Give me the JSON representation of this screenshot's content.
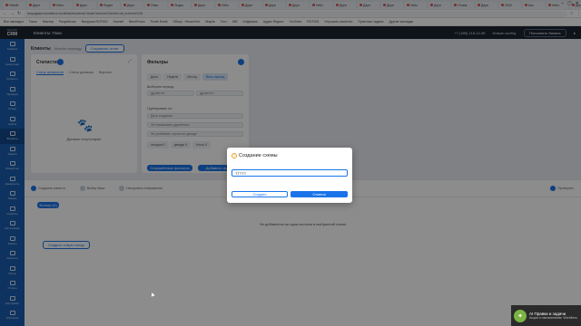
{
  "browser": {
    "tabs": [
      "HelloB",
      "Дерп",
      "Hello",
      "Дерп",
      "Яндек",
      "Дерп",
      "Obse",
      "Яндек",
      "Дерп",
      "Hello",
      "Дерп",
      "Дерп",
      "Дерп",
      "Hello",
      "Дерп",
      "Дерп",
      "Дерп",
      "Hello",
      "Дерп",
      "Отзыв",
      "Дерп",
      "2000",
      "Бак",
      "Hello",
      "Дерп",
      "Ct",
      "Дерп",
      "Дерп"
    ],
    "active_tab_index": 25,
    "url": "вгорадмин.worldlens.ru/clients/#schemeCreate?schemeClientId=all_scheme%3D",
    "bookmarks": [
      "Все закладки",
      "Таско",
      "Мастер",
      "Разработка",
      "Выгрузка ROTMO",
      "Kavneli",
      "BeneRoom",
      "Ponte Email",
      "Обзор - НескоГете",
      "Maplia",
      "Тест",
      "ИМ",
      "ИнДвижок",
      "Аудио Яндекс",
      "YouTube",
      "ROTMO",
      "Улучшить качество",
      "Пунктные задачи",
      "Другие закладки"
    ]
  },
  "topbar": {
    "logo_main": "CRM",
    "logo_sub": "MACRO",
    "page_name": "Клиенты: Поки",
    "phone": "+7 (495) 118-13-95",
    "notifications": "Новые сообщ.",
    "pay_label": "Пополнить баланс"
  },
  "sidebar": [
    "Главная",
    "Аналитика",
    "Клиенты",
    "Продажи",
    "Склад",
    "Сайты",
    "Финансы",
    "Задачи",
    "Общий чат",
    "Документы",
    "Товары",
    "Сервисы",
    "Интеграции",
    "Заказы",
    "Каталоги",
    "Почта",
    "Отчеты",
    "Настройки",
    "Обучение"
  ],
  "main": {
    "title": "Клиенты",
    "subtitle": "Мои/по периоду",
    "create_button": "Сохранить отчет",
    "stats": {
      "title": "Статистика",
      "tabs": [
        "Статус активности",
        "Статус договора",
        "Воронки"
      ],
      "empty": "Данные отсутствуют"
    },
    "filters": {
      "title": "Фильтры",
      "tabs": [
        "День",
        "Неделя",
        "Месяц",
        "Весь период"
      ],
      "period_label": "Выберите период:",
      "date_from": "дд.мм.гггг",
      "date_to": "дд.мм.гггг",
      "group_label": "Группировать по:",
      "fields": [
        "Дата создания",
        "Не показывать удалённых",
        "Не разбивать строки по декаде"
      ],
      "toggles": [
        "сегодня 0",
        "декаде 0",
        "Итого 0"
      ],
      "save_button": "Сохранённые фильтры",
      "apply_button": "Добавить фильтр"
    },
    "steps": [
      "Создание клиента",
      "Выбор базы",
      "Настройка отображения"
    ],
    "step_right": "Проверить",
    "content": {
      "filter_button": "Фильтр (0)",
      "empty": "Не добавлены ни одна колонка в выбранной схеме",
      "create_button": "Создать новую схему"
    }
  },
  "modal": {
    "title": "Создание схемы",
    "input_value": "ТТТТТ",
    "cancel": "Создать",
    "ok": "Отмена"
  },
  "toast": {
    "title": "AI Правки и задачи",
    "subtitle": "Акции и напоминания: Worldlens"
  }
}
